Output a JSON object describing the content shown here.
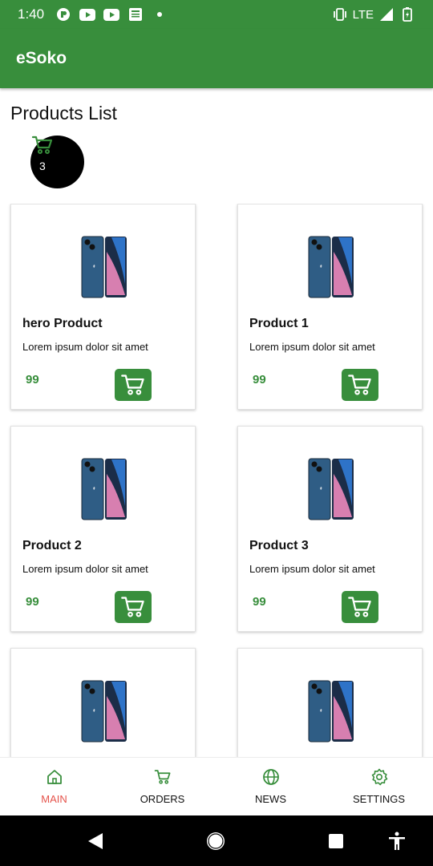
{
  "status_bar": {
    "time": "1:40",
    "network": "LTE"
  },
  "app_bar": {
    "title": "eSoko"
  },
  "page": {
    "heading": "Products List"
  },
  "cart": {
    "count": "3"
  },
  "products": [
    {
      "name": "hero Product",
      "description": "Lorem ipsum dolor sit amet",
      "price": "99"
    },
    {
      "name": "Product 1",
      "description": "Lorem ipsum dolor sit amet",
      "price": "99"
    },
    {
      "name": "Product 2",
      "description": "Lorem ipsum dolor sit amet",
      "price": "99"
    },
    {
      "name": "Product 3",
      "description": "Lorem ipsum dolor sit amet",
      "price": "99"
    },
    {
      "name": "",
      "description": "",
      "price": ""
    },
    {
      "name": "",
      "description": "",
      "price": ""
    }
  ],
  "bottom_nav": {
    "items": [
      {
        "label": "MAIN",
        "icon": "home-icon",
        "active": true
      },
      {
        "label": "ORDERS",
        "icon": "cart-icon",
        "active": false
      },
      {
        "label": "NEWS",
        "icon": "globe-icon",
        "active": false
      },
      {
        "label": "SETTINGS",
        "icon": "gear-icon",
        "active": false
      }
    ]
  },
  "colors": {
    "primary": "#388e3c",
    "active_nav": "#e5534b",
    "badge": "#000000"
  }
}
